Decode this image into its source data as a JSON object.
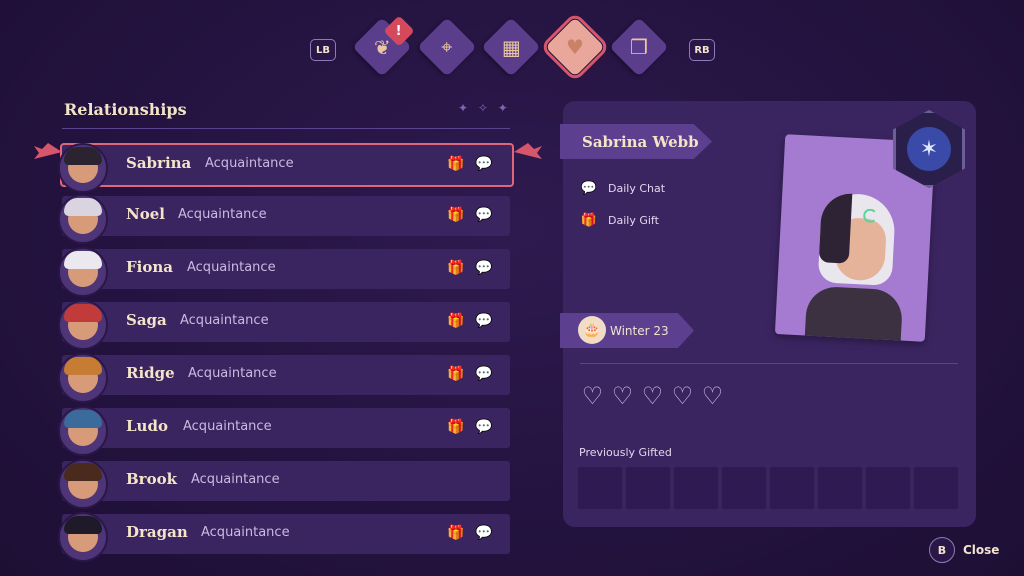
{
  "header": {
    "lb_label": "LB",
    "rb_label": "RB",
    "alert_glyph": "!",
    "tabs": [
      {
        "icon": "quest-scroll-icon",
        "glyph": "❦"
      },
      {
        "icon": "map-icon",
        "glyph": "⌖"
      },
      {
        "icon": "calendar-icon",
        "glyph": "▦"
      },
      {
        "icon": "heart-icon",
        "glyph": "♥"
      },
      {
        "icon": "book-icon",
        "glyph": "❒"
      }
    ]
  },
  "relationships": {
    "title": "Relationships",
    "items": [
      {
        "name": "Sabrina",
        "status": "Acquaintance",
        "gift": true,
        "chat": true,
        "hair_color": "#2b2330"
      },
      {
        "name": "Noel",
        "status": "Acquaintance",
        "gift": true,
        "chat": true,
        "hair_color": "#d9d4e0"
      },
      {
        "name": "Fiona",
        "status": "Acquaintance",
        "gift": true,
        "chat": true,
        "hair_color": "#ece8f0"
      },
      {
        "name": "Saga",
        "status": "Acquaintance",
        "gift": true,
        "chat": true,
        "hair_color": "#c23b3b"
      },
      {
        "name": "Ridge",
        "status": "Acquaintance",
        "gift": true,
        "chat": true,
        "hair_color": "#c77c33"
      },
      {
        "name": "Ludo",
        "status": "Acquaintance",
        "gift": true,
        "chat": true,
        "hair_color": "#3a6b9a"
      },
      {
        "name": "Brook",
        "status": "Acquaintance",
        "gift": false,
        "chat": false,
        "hair_color": "#4a2a1d"
      },
      {
        "name": "Dragan",
        "status": "Acquaintance",
        "gift": true,
        "chat": true,
        "hair_color": "#1f1a2a"
      }
    ]
  },
  "detail": {
    "full_name": "Sabrina Webb",
    "daily_chat": "Daily Chat",
    "daily_gift": "Daily Gift",
    "birthday": "Winter 23",
    "previously_gifted": "Previously Gifted",
    "hearts_filled": 0,
    "hearts_total": 5,
    "gift_slots": 8
  },
  "footer": {
    "b_label": "B",
    "close_label": "Close"
  },
  "icons": {
    "heart": "♡",
    "gift": "🎁",
    "chat": "💬",
    "cake": "🎂",
    "crest": "🐦"
  }
}
